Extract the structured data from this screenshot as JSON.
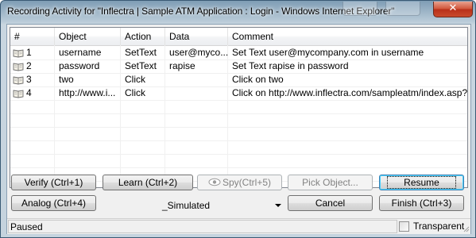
{
  "window": {
    "title": "Recording Activity for \"Inflectra | Sample ATM Application : Login - Windows Internet Explorer\"",
    "close_glyph": "✕"
  },
  "grid": {
    "columns": [
      "#",
      "Object",
      "Action",
      "Data",
      "Comment"
    ],
    "rows": [
      {
        "num": "1",
        "object": "username",
        "action": "SetText",
        "data": "user@myco...",
        "comment": "Set Text user@mycompany.com in username"
      },
      {
        "num": "2",
        "object": "password",
        "action": "SetText",
        "data": "rapise",
        "comment": "Set Text rapise in password"
      },
      {
        "num": "3",
        "object": "two",
        "action": "Click",
        "data": "",
        "comment": "Click on two"
      },
      {
        "num": "4",
        "object": "http://www.i...",
        "action": "Click",
        "data": "",
        "comment": "Click on http://www.inflectra.com/sampleatm/index.asp?fu..."
      }
    ]
  },
  "buttons": {
    "verify": "Verify (Ctrl+1)",
    "learn": "Learn (Ctrl+2)",
    "spy": "Spy(Ctrl+5)",
    "pick_object": "Pick Object...",
    "resume": "Resume",
    "analog": "Analog (Ctrl+4)",
    "cancel": "Cancel",
    "finish": "Finish (Ctrl+3)"
  },
  "mode_select": {
    "value": "_Simulated"
  },
  "status": {
    "text": "Paused",
    "transparent_label": "Transparent",
    "transparent_checked": false
  }
}
